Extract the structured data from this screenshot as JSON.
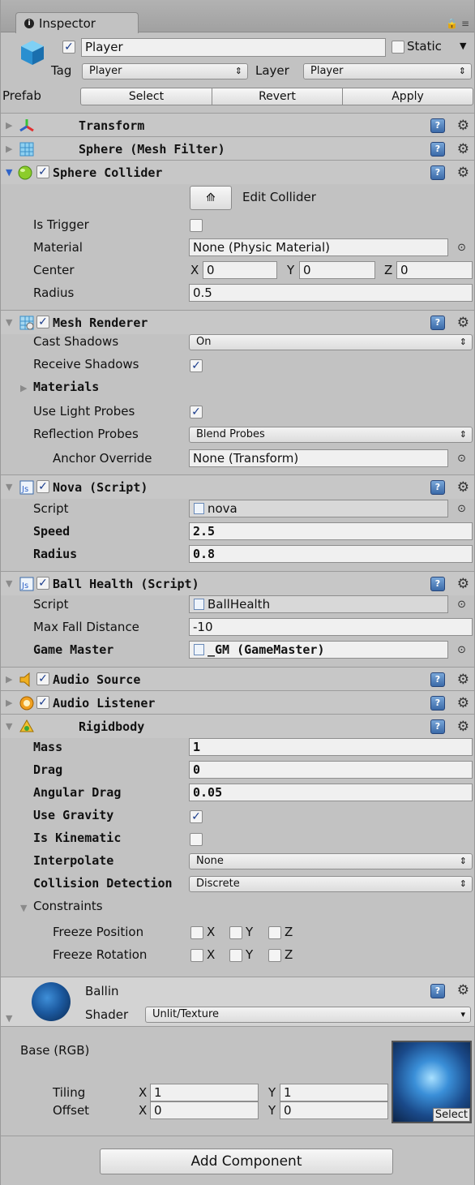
{
  "tab": {
    "title": "Inspector"
  },
  "gameobject": {
    "name": "Player",
    "static_label": "Static",
    "tag_label": "Tag",
    "tag_value": "Player",
    "layer_label": "Layer",
    "layer_value": "Player",
    "prefab_label": "Prefab",
    "prefab_buttons": [
      "Select",
      "Revert",
      "Apply"
    ]
  },
  "components": {
    "transform": {
      "name": "Transform"
    },
    "mesh_filter": {
      "name": "Sphere (Mesh Filter)"
    },
    "sphere_collider": {
      "name": "Sphere Collider",
      "edit_label": "Edit Collider",
      "is_trigger_label": "Is Trigger",
      "material_label": "Material",
      "material_value": "None (Physic Material)",
      "center_label": "Center",
      "center_x": "0",
      "center_y": "0",
      "center_z": "0",
      "radius_label": "Radius",
      "radius_value": "0.5"
    },
    "mesh_renderer": {
      "name": "Mesh Renderer",
      "cast_shadows_label": "Cast Shadows",
      "cast_shadows_value": "On",
      "receive_shadows_label": "Receive Shadows",
      "materials_label": "Materials",
      "light_probes_label": "Use Light Probes",
      "reflection_label": "Reflection Probes",
      "reflection_value": "Blend Probes",
      "anchor_label": "Anchor Override",
      "anchor_value": "None (Transform)"
    },
    "nova": {
      "name": "Nova (Script)",
      "script_label": "Script",
      "script_value": "nova",
      "speed_label": "Speed",
      "speed_value": "2.5",
      "radius_label": "Radius",
      "radius_value": "0.8"
    },
    "ball_health": {
      "name": "Ball Health (Script)",
      "script_label": "Script",
      "script_value": "BallHealth",
      "max_fall_label": "Max Fall Distance",
      "max_fall_value": "-10",
      "game_master_label": "Game Master",
      "game_master_value": "_GM (GameMaster)"
    },
    "audio_source": {
      "name": "Audio Source"
    },
    "audio_listener": {
      "name": "Audio Listener"
    },
    "rigidbody": {
      "name": "Rigidbody",
      "mass_label": "Mass",
      "mass_value": "1",
      "drag_label": "Drag",
      "drag_value": "0",
      "angular_label": "Angular Drag",
      "angular_value": "0.05",
      "gravity_label": "Use Gravity",
      "kinematic_label": "Is Kinematic",
      "interpolate_label": "Interpolate",
      "interpolate_value": "None",
      "collision_label": "Collision Detection",
      "collision_value": "Discrete",
      "constraints_label": "Constraints",
      "freeze_pos_label": "Freeze Position",
      "freeze_rot_label": "Freeze Rotation",
      "x": "X",
      "y": "Y",
      "z": "Z"
    }
  },
  "material": {
    "name": "Ballin",
    "shader_label": "Shader",
    "shader_value": "Unlit/Texture",
    "base_label": "Base (RGB)",
    "tiling_label": "Tiling",
    "tiling_x": "1",
    "tiling_y": "1",
    "offset_label": "Offset",
    "offset_x": "0",
    "offset_y": "0",
    "select_label": "Select",
    "x": "X",
    "y": "Y"
  },
  "add_component": "Add Component",
  "icons": {
    "help": "?",
    "gear": "⚙",
    "target": "⊙"
  }
}
